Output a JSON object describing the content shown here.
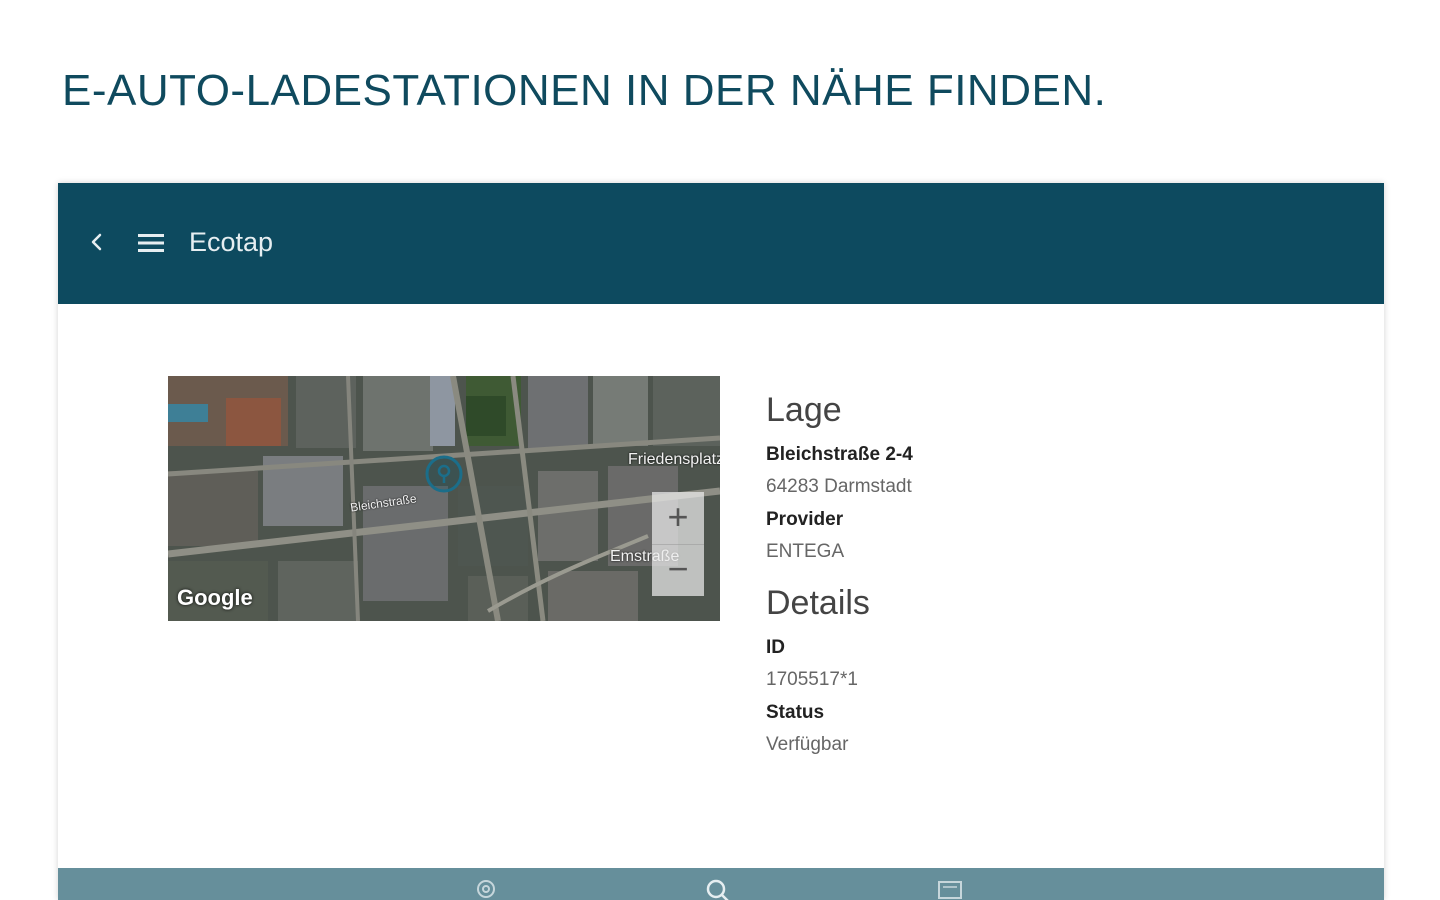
{
  "page": {
    "headline": "E-AUTO-LADESTATIONEN IN DER NÄHE FINDEN."
  },
  "appbar": {
    "back_icon": "chevron-left-icon",
    "menu_icon": "hamburger-menu-icon",
    "title": "Ecotap",
    "color": "#0d4a5f"
  },
  "map": {
    "type": "satellite",
    "marker_icon": "location-pin-icon",
    "streets": [
      "Friedensplatz",
      "Bleichstraße",
      "Emstraße"
    ],
    "zoom_in": "+",
    "zoom_out": "−",
    "attribution": "Google"
  },
  "lage": {
    "title": "Lage",
    "address_line1": "Bleichstraße 2-4",
    "address_line2": "64283 Darmstadt",
    "provider_label": "Provider",
    "provider_value": "ENTEGA"
  },
  "details": {
    "title": "Details",
    "id_label": "ID",
    "id_value": "1705517*1",
    "status_label": "Status",
    "status_value": "Verfügbar"
  },
  "bottombar": {
    "color": "#668f9b",
    "icons": [
      "location-icon",
      "search-icon",
      "list-icon"
    ]
  }
}
